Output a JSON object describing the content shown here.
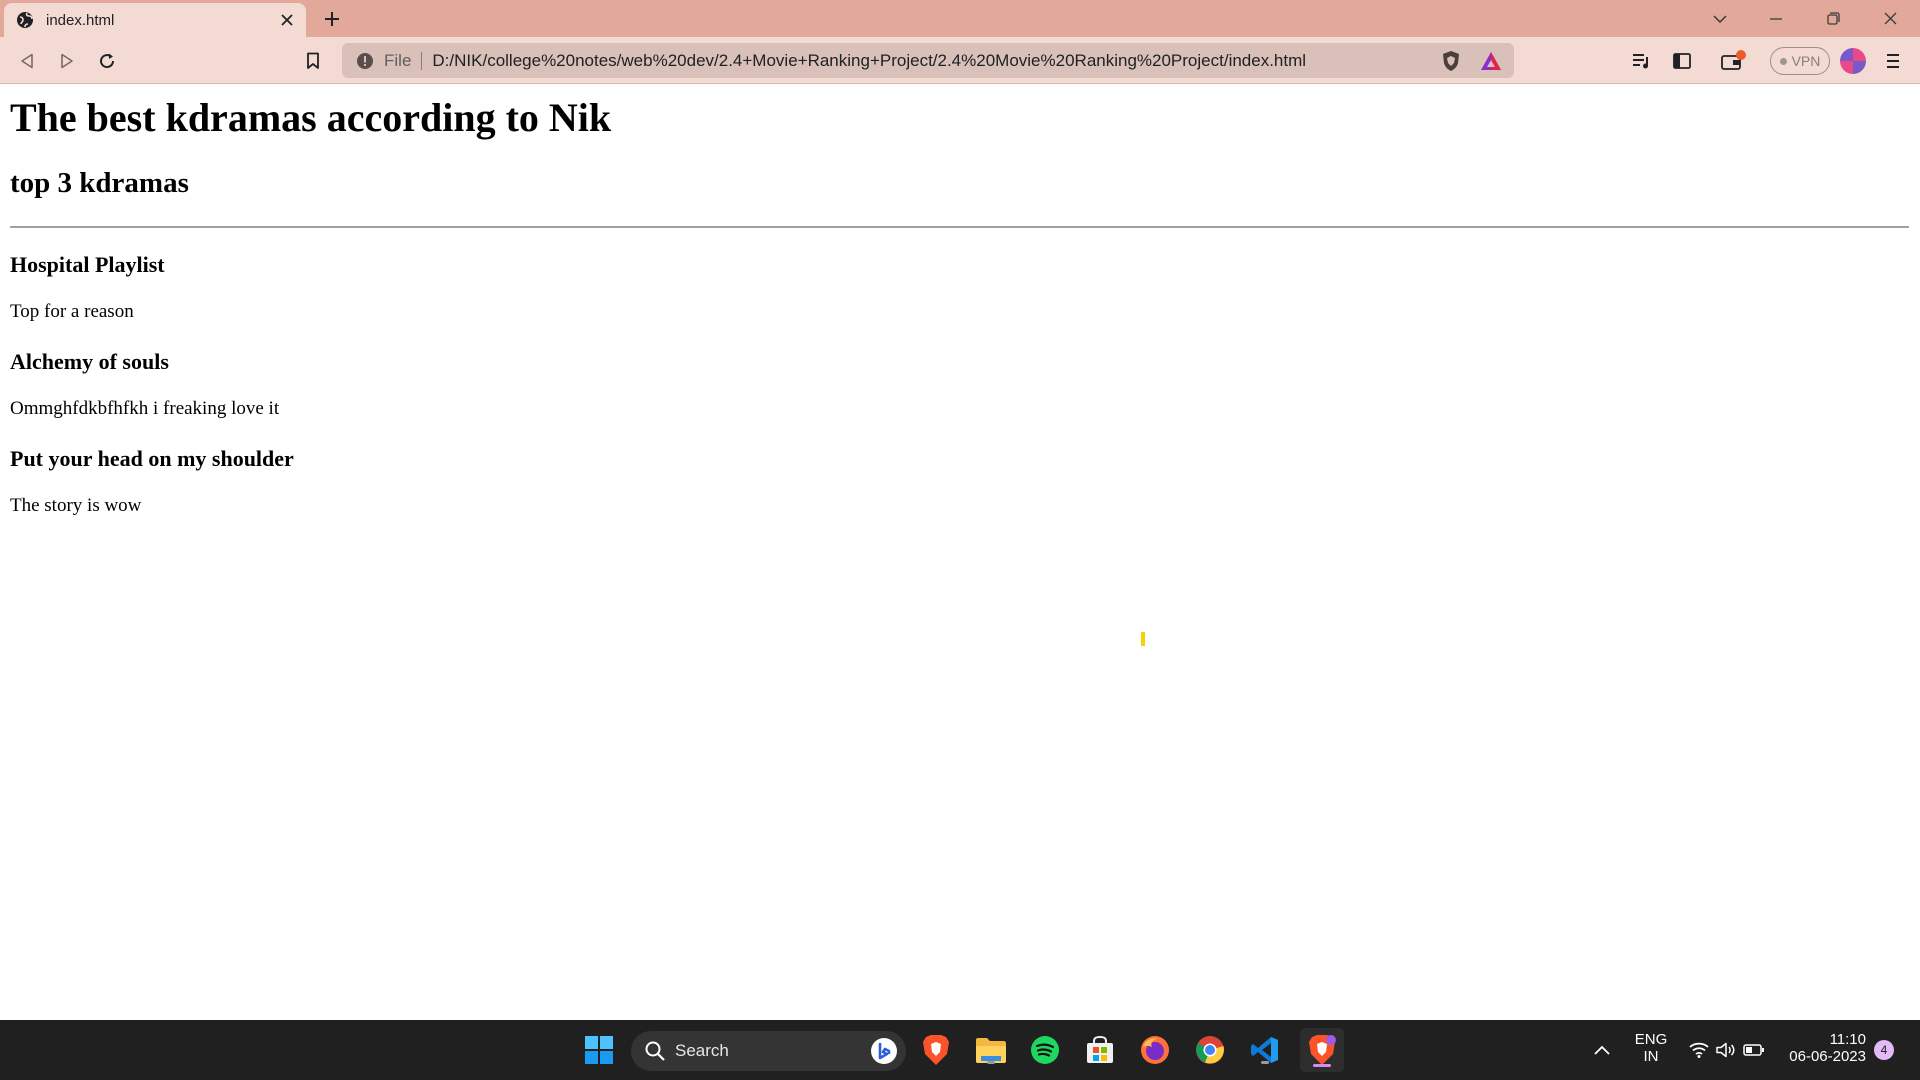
{
  "browser": {
    "tab": {
      "title": "index.html"
    },
    "toolbar": {
      "scheme_label": "File",
      "url": "D:/NIK/college%20notes/web%20dev/2.4+Movie+Ranking+Project/2.4%20Movie%20Ranking%20Project/index.html",
      "vpn_label": "VPN"
    },
    "colors": {
      "tabstrip": "#e2a99a",
      "toolbar": "#f3dbd4",
      "omnibox": "#d9c1ba"
    }
  },
  "page": {
    "title": "The best kdramas according to Nik",
    "subtitle": "top 3 kdramas",
    "entries": [
      {
        "name": "Hospital Playlist",
        "comment": "Top for a reason"
      },
      {
        "name": "Alchemy of souls",
        "comment": "Ommghfdkbfhfkh i freaking love it"
      },
      {
        "name": "Put your head on my shoulder",
        "comment": "The story is wow"
      }
    ]
  },
  "taskbar": {
    "search_label": "Search",
    "language": {
      "line1": "ENG",
      "line2": "IN"
    },
    "clock": {
      "time": "11:10",
      "date": "06-06-2023"
    },
    "notification_count": "4",
    "apps": [
      "windows-start-icon",
      "brave-icon",
      "file-explorer-icon",
      "spotify-icon",
      "microsoft-store-icon",
      "firefox-icon",
      "chrome-icon",
      "vscode-icon",
      "brave-beta-icon"
    ]
  }
}
